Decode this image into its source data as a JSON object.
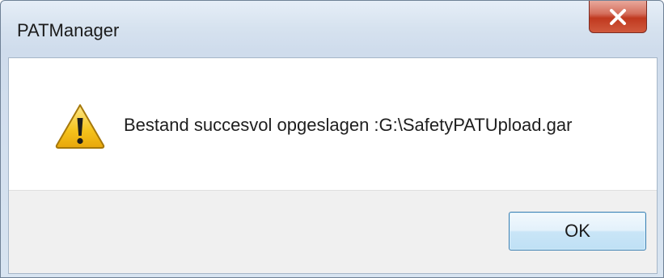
{
  "window": {
    "title": "PATManager",
    "close_icon": "close-icon"
  },
  "dialog": {
    "icon": "warning-icon",
    "message": "Bestand succesvol opgeslagen :G:\\SafetyPATUpload.gar",
    "ok_label": "OK"
  },
  "colors": {
    "close_button": "#c0391f",
    "ok_button_border": "#3c7fb1",
    "warning_yellow": "#f5c21b"
  }
}
